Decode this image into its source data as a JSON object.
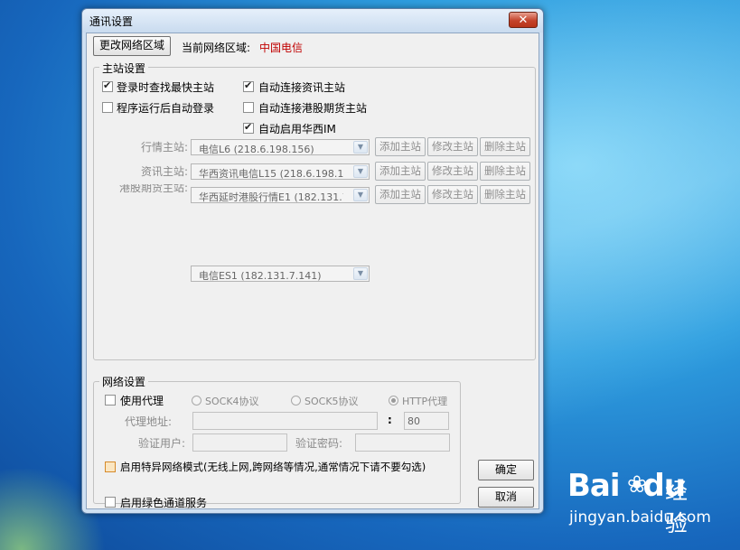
{
  "window": {
    "title": "通讯设置",
    "close_label": "✕"
  },
  "top": {
    "change_region_button": "更改网络区域",
    "current_region_label": "当前网络区域:",
    "current_region_value": "中国电信"
  },
  "main_station": {
    "legend": "主站设置",
    "checks": [
      {
        "label": "登录时查找最快主站",
        "checked": true
      },
      {
        "label": "自动连接资讯主站",
        "checked": true
      },
      {
        "label": "程序运行后自动登录",
        "checked": false
      },
      {
        "label": "自动连接港股期货主站",
        "checked": false
      },
      {
        "label": "自动启用华西IM",
        "checked": true
      }
    ],
    "rows": [
      {
        "label": "行情主站:",
        "value": "电信L6 (218.6.198.156)"
      },
      {
        "label": "资讯主站:",
        "value": "华西资讯电信L15 (218.6.198.19"
      },
      {
        "label": "港股期货主站:",
        "value": "华西延时港股行情E1 (182.131.7"
      }
    ],
    "add_label": "添加主站",
    "edit_label": "修改主站",
    "delete_label": "删除主站",
    "extra_combo_value": "电信ES1 (182.131.7.141)"
  },
  "network": {
    "legend": "网络设置",
    "use_proxy_label": "使用代理",
    "sock4_label": "SOCK4协议",
    "sock5_label": "SOCK5协议",
    "http_label": "HTTP代理",
    "proxy_address_label": "代理地址:",
    "colon": ":",
    "port_value": "80",
    "auth_user_label": "验证用户:",
    "auth_password_label": "验证密码:",
    "special_mode_label": "启用特异网络模式(无线上网,跨网络等情况,通常情况下请不要勾选)",
    "green_channel_label": "启用绿色通道服务"
  },
  "buttons": {
    "ok": "确定",
    "cancel": "取消"
  },
  "watermark": {
    "logo": "Bai",
    "logo2": "du",
    "cn": "经验",
    "url": "jingyan.baidu.com"
  },
  "colors": {
    "region_value": "#c00000",
    "desktop": "#2f9fe0"
  }
}
